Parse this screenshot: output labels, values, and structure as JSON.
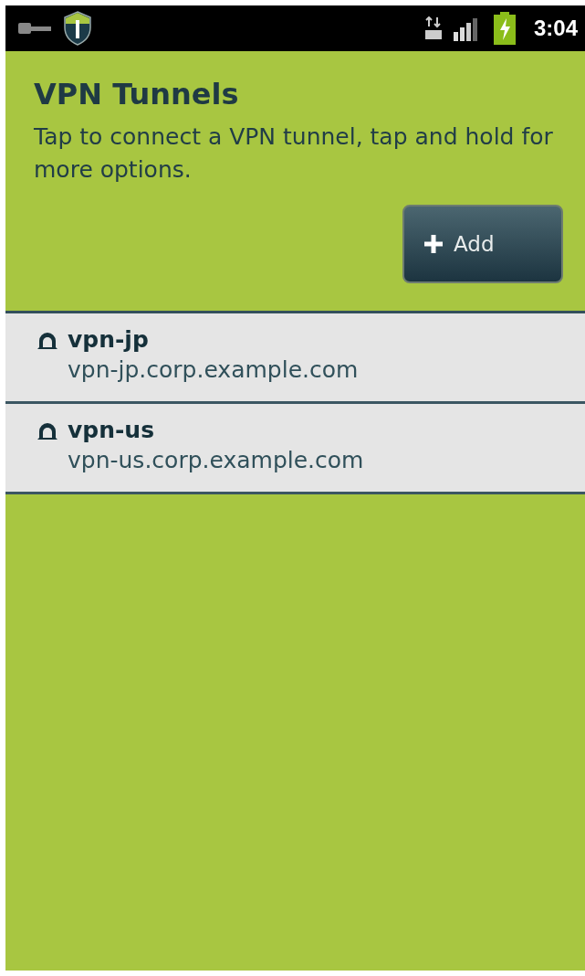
{
  "status_bar": {
    "time": "3:04"
  },
  "header": {
    "title": "VPN Tunnels",
    "subtitle": "Tap to connect a VPN tunnel, tap and hold for more options.",
    "add_button": "Add"
  },
  "tunnels": [
    {
      "name": "vpn-jp",
      "host": "vpn-jp.corp.example.com"
    },
    {
      "name": "vpn-us",
      "host": "vpn-us.corp.example.com"
    }
  ]
}
